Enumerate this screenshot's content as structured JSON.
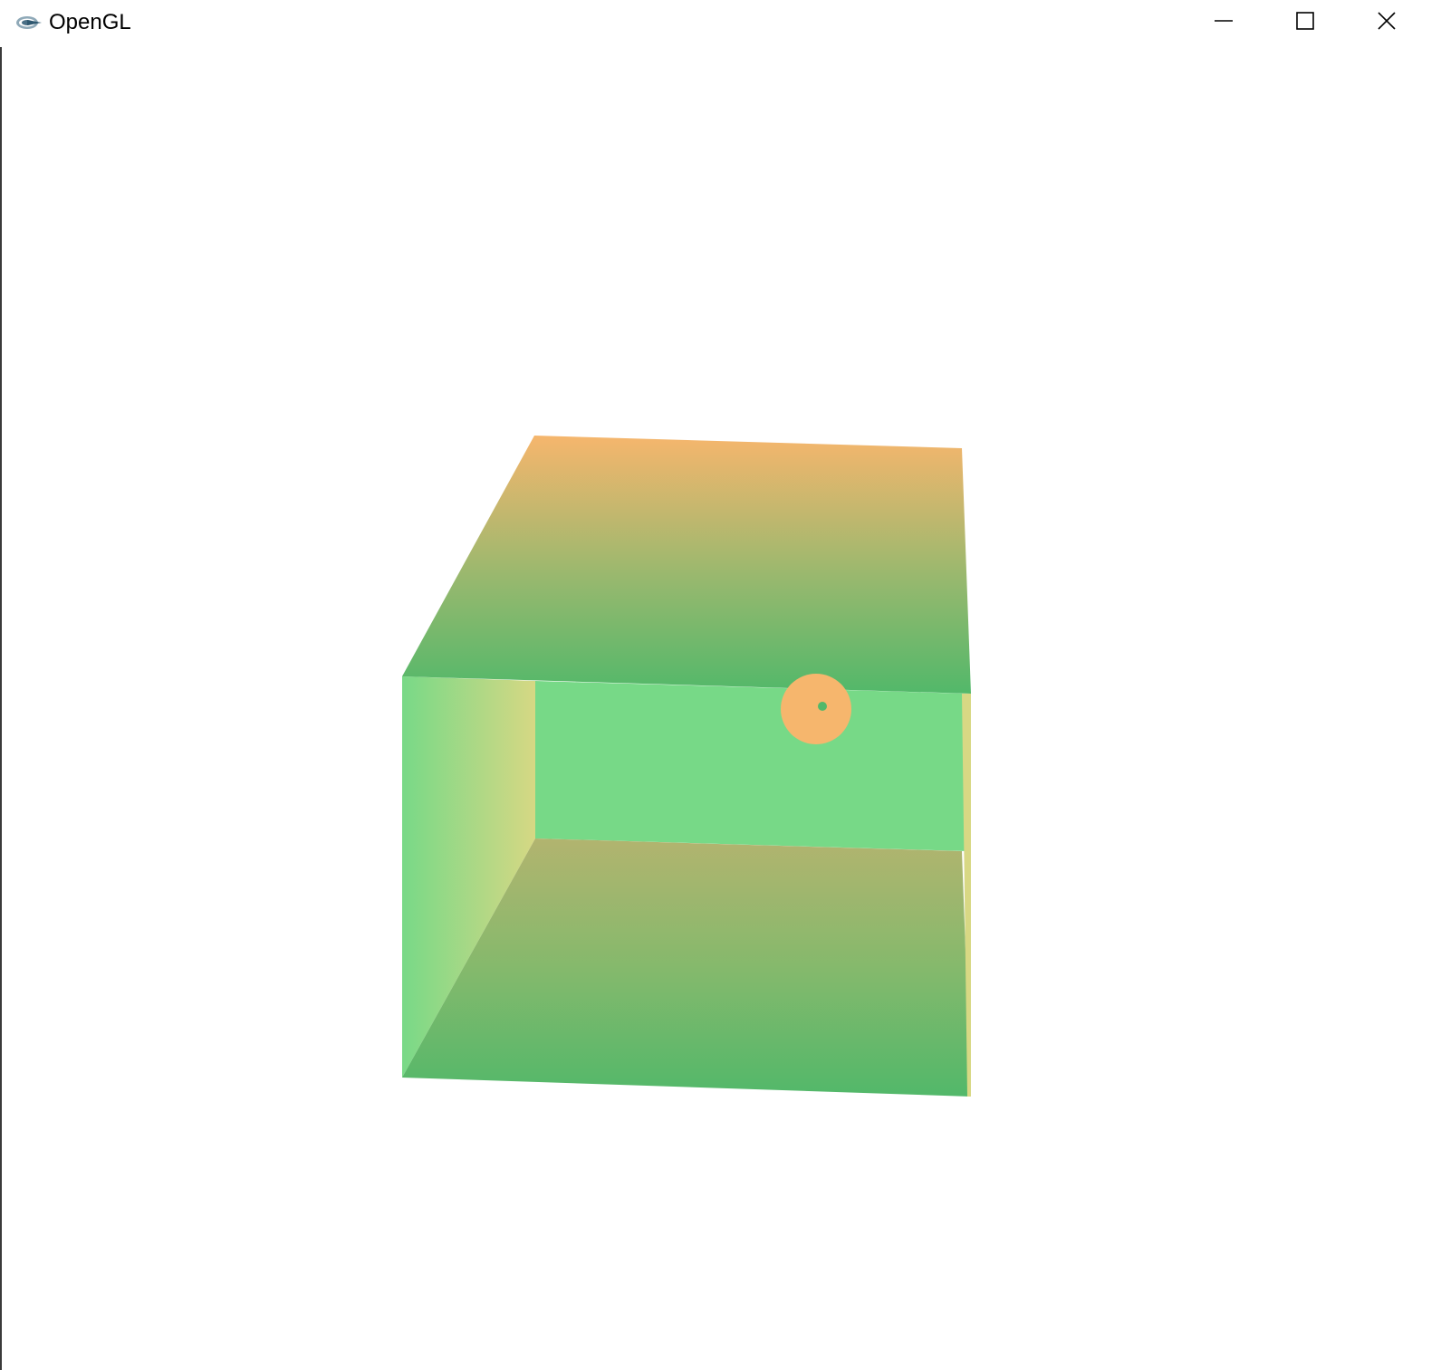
{
  "window": {
    "title": "OpenGL",
    "app_icon": "opengl-logo-icon",
    "controls": {
      "minimize": "minimize-icon",
      "maximize": "maximize-icon",
      "close": "close-icon"
    }
  },
  "scene": {
    "description_icon": "cube",
    "colors": {
      "green_light": "#77d987",
      "green_mid": "#57b86c",
      "orange": "#f6b66d",
      "yellow": "#d8d884",
      "background": "#ffffff"
    }
  }
}
